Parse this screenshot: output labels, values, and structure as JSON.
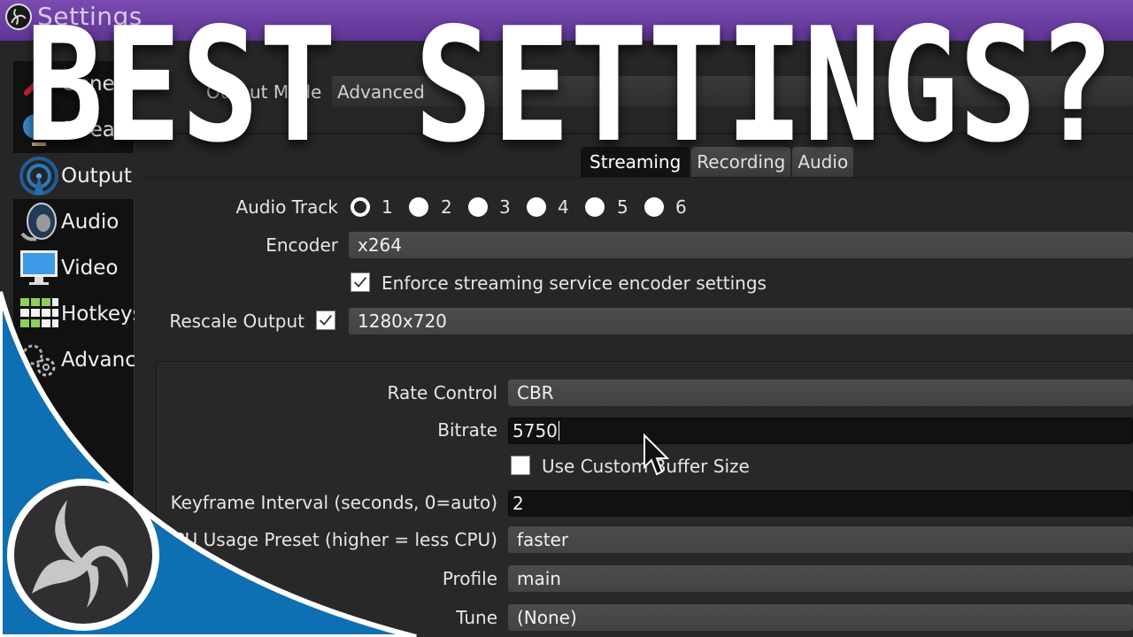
{
  "window": {
    "title": "Settings",
    "titlebar_color": "#6b3fa4"
  },
  "overlay": {
    "headline": "BEST SETTINGS?",
    "swoosh_color": "#0e6fb2"
  },
  "sidebar": {
    "items": [
      {
        "label": "General",
        "icon": "general-icon",
        "active": false
      },
      {
        "label": "Stream",
        "icon": "globe-icon",
        "active": false
      },
      {
        "label": "Output",
        "icon": "antenna-icon",
        "active": true
      },
      {
        "label": "Audio",
        "icon": "speaker-icon",
        "active": false
      },
      {
        "label": "Video",
        "icon": "monitor-icon",
        "active": false
      },
      {
        "label": "Hotkeys",
        "icon": "keyboard-icon",
        "active": false
      },
      {
        "label": "Advanced",
        "icon": "gears-icon",
        "active": false
      }
    ]
  },
  "output_mode": {
    "label": "Output Mode",
    "value": "Advanced"
  },
  "tabs": [
    {
      "label": "Streaming",
      "active": true
    },
    {
      "label": "Recording",
      "active": false
    },
    {
      "label": "Audio",
      "active": false
    }
  ],
  "streaming": {
    "audio_track": {
      "label": "Audio Track",
      "options": [
        "1",
        "2",
        "3",
        "4",
        "5",
        "6"
      ],
      "selected": "1"
    },
    "encoder": {
      "label": "Encoder",
      "value": "x264"
    },
    "enforce": {
      "label": "Enforce streaming service encoder settings",
      "checked": true
    },
    "rescale": {
      "label": "Rescale Output",
      "checked": true,
      "value": "1280x720"
    },
    "rate_control": {
      "label": "Rate Control",
      "value": "CBR"
    },
    "bitrate": {
      "label": "Bitrate",
      "value": "5750"
    },
    "custom_buffer": {
      "label": "Use Custom Buffer Size",
      "checked": false
    },
    "keyframe": {
      "label": "Keyframe Interval (seconds, 0=auto)",
      "value": "2"
    },
    "cpu_preset": {
      "label": "CPU Usage Preset (higher = less CPU)",
      "value": "faster"
    },
    "profile": {
      "label": "Profile",
      "value": "main"
    },
    "tune": {
      "label": "Tune",
      "value": "(None)"
    }
  }
}
